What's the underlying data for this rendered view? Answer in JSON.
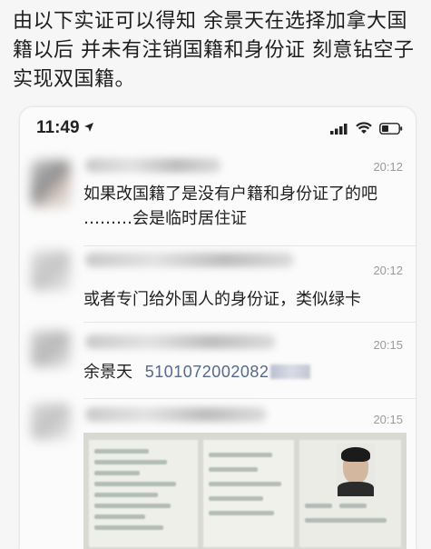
{
  "caption": {
    "line1": "由以下实证可以得知 余景天在选择加拿大国",
    "line2": "籍以后 并未有注销国籍和身份证 刻意钻空子",
    "line3": "实现双国籍。"
  },
  "status_bar": {
    "time": "11:49"
  },
  "messages": [
    {
      "time": "20:12",
      "line1": "如果改国籍了是没有户籍和身份证了的吧",
      "line2": "………会是临时居住证"
    },
    {
      "time": "20:12",
      "line1": "或者专门给外国人的身份证，类似绿卡"
    },
    {
      "time": "20:15",
      "name": "余景天",
      "id_number": "5101072002082"
    },
    {
      "time": "20:15"
    }
  ],
  "colors": {
    "link_blue": "#56698a",
    "timestamp_gray": "#9a9a9a"
  }
}
